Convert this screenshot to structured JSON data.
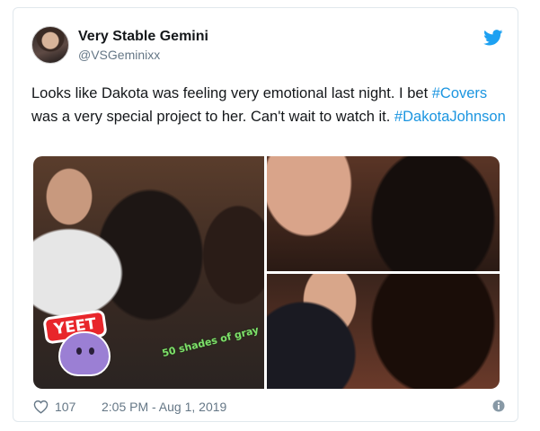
{
  "tweet": {
    "display_name": "Very Stable Gemini",
    "handle": "@VSGeminixx",
    "text_part1": "Looks like Dakota was feeling very emotional last night. I bet ",
    "hashtag1": "#Covers",
    "text_part2": " was a very special project to her. Can't wait to watch it. ",
    "hashtag2": "#DakotaJohnson",
    "sticker_yeet": "YEET",
    "sticker_caption": "50 shades of gray",
    "likes": "107",
    "timestamp": "2:05 PM - Aug 1, 2019"
  },
  "icons": {
    "platform": "twitter-bird-icon",
    "like": "heart-icon",
    "info": "info-icon"
  },
  "colors": {
    "accent": "#1da1f2",
    "link": "#1b95e0",
    "muted": "#657786"
  }
}
